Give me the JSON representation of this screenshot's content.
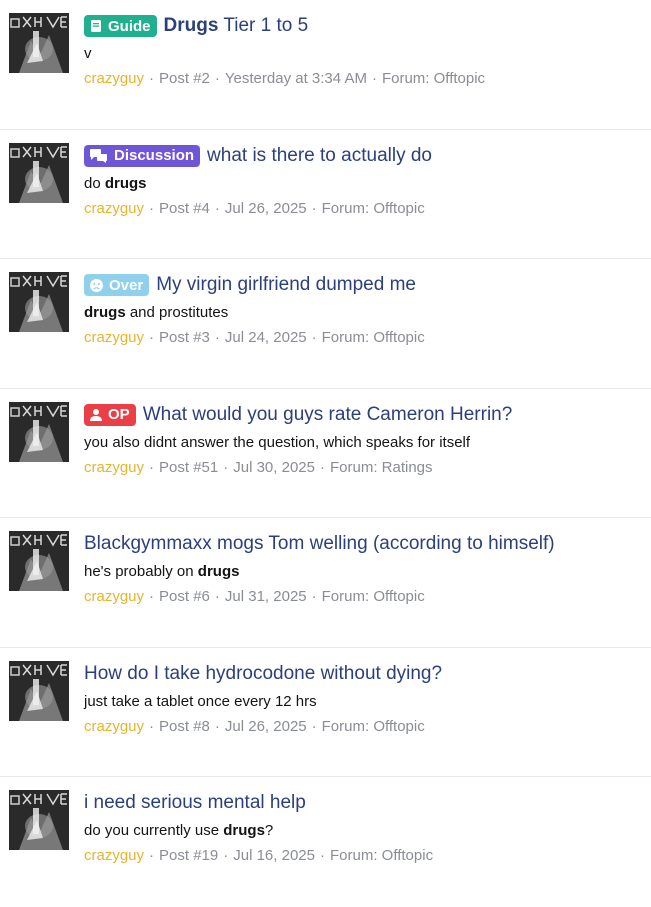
{
  "results": [
    {
      "badge": {
        "label": "Guide",
        "color": "#20b090",
        "icon": "book-icon"
      },
      "title_highlight": "Drugs",
      "title_rest": " Tier 1 to 5",
      "snippet": [
        {
          "t": "v"
        }
      ],
      "username": "crazyguy",
      "post": "Post #2",
      "date": "Yesterday at 3:34 AM",
      "forum": "Forum: Offtopic"
    },
    {
      "badge": {
        "label": "Discussion",
        "color": "#6f56d9",
        "icon": "chat-bubbles-icon"
      },
      "title_highlight": "",
      "title_rest": "what is there to actually do",
      "snippet": [
        {
          "t": "do "
        },
        {
          "t": "drugs",
          "b": true
        }
      ],
      "username": "crazyguy",
      "post": "Post #4",
      "date": "Jul 26, 2025",
      "forum": "Forum: Offtopic"
    },
    {
      "badge": {
        "label": "Over",
        "color": "#8fd0ec",
        "icon": "sad-face-icon"
      },
      "title_highlight": "",
      "title_rest": "My virgin girlfriend dumped me",
      "snippet": [
        {
          "t": "drugs",
          "b": true
        },
        {
          "t": " and prostitutes"
        }
      ],
      "username": "crazyguy",
      "post": "Post #3",
      "date": "Jul 24, 2025",
      "forum": "Forum: Offtopic"
    },
    {
      "badge": {
        "label": "OP",
        "color": "#ea3f46",
        "icon": "user-icon"
      },
      "title_highlight": "",
      "title_rest": "What would you guys rate Cameron Herrin?",
      "snippet": [
        {
          "t": "you also didnt answer the question, which speaks for itself"
        }
      ],
      "username": "crazyguy",
      "post": "Post #51",
      "date": "Jul 30, 2025",
      "forum": "Forum: Ratings"
    },
    {
      "badge": null,
      "title_highlight": "",
      "title_rest": "Blackgymmaxx mogs Tom welling (according to himself)",
      "snippet": [
        {
          "t": "he's probably on "
        },
        {
          "t": "drugs",
          "b": true
        }
      ],
      "username": "crazyguy",
      "post": "Post #6",
      "date": "Jul 31, 2025",
      "forum": "Forum: Offtopic"
    },
    {
      "badge": null,
      "title_highlight": "",
      "title_rest": "How do I take hydrocodone without dying?",
      "snippet": [
        {
          "t": "just take a tablet once every 12 hrs"
        }
      ],
      "username": "crazyguy",
      "post": "Post #8",
      "date": "Jul 26, 2025",
      "forum": "Forum: Offtopic"
    },
    {
      "badge": null,
      "title_highlight": "",
      "title_rest": "i need serious mental help",
      "snippet": [
        {
          "t": "do you currently use "
        },
        {
          "t": "drugs",
          "b": true
        },
        {
          "t": "?"
        }
      ],
      "username": "crazyguy",
      "post": "Post #19",
      "date": "Jul 16, 2025",
      "forum": "Forum: Offtopic"
    }
  ],
  "separator": "·"
}
